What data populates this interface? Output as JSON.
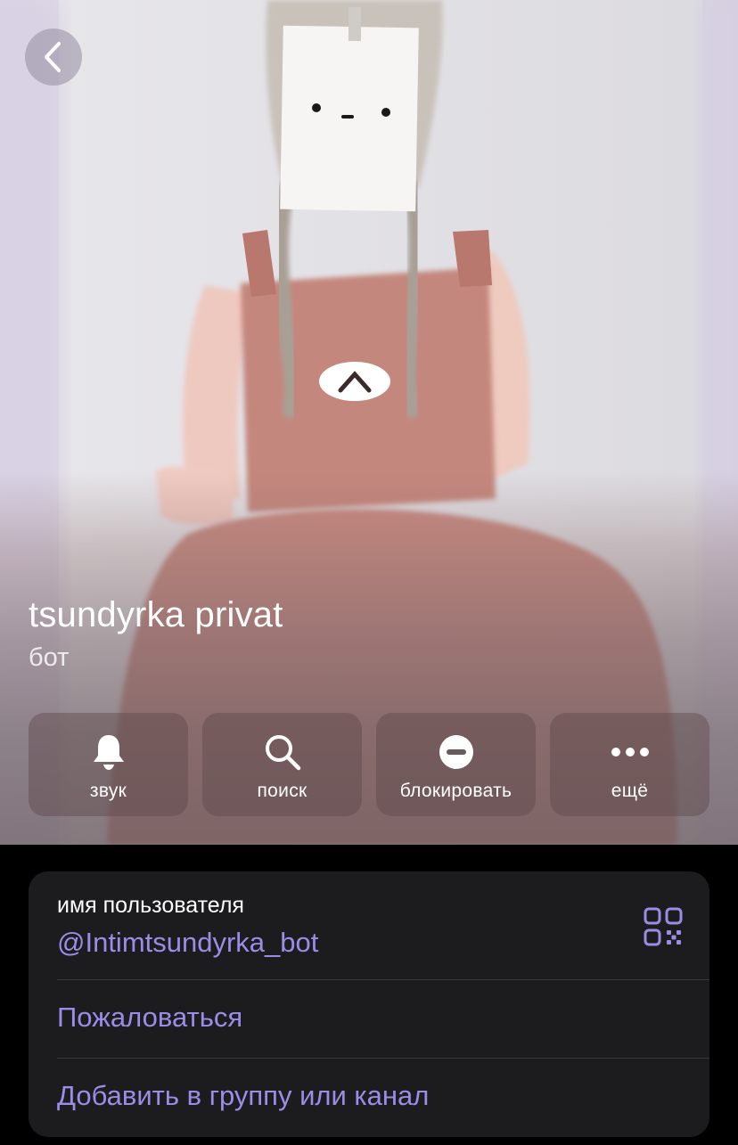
{
  "profile": {
    "name": "tsundyrka privat",
    "status": "бот"
  },
  "actions": [
    {
      "label": "звук",
      "icon": "bell-icon"
    },
    {
      "label": "поиск",
      "icon": "search-icon"
    },
    {
      "label": "блокировать",
      "icon": "block-icon"
    },
    {
      "label": "ещё",
      "icon": "more-icon"
    }
  ],
  "info": {
    "username_caption": "имя пользователя",
    "username": "@Intimtsundyrka_bot",
    "qr_icon": "qr-code-icon",
    "report_label": "Пожаловаться",
    "add_to_group_label": "Добавить в группу или канал"
  },
  "colors": {
    "accent": "#9b8ce6",
    "card_background": "#1c1c1e",
    "page_background": "#000000"
  }
}
